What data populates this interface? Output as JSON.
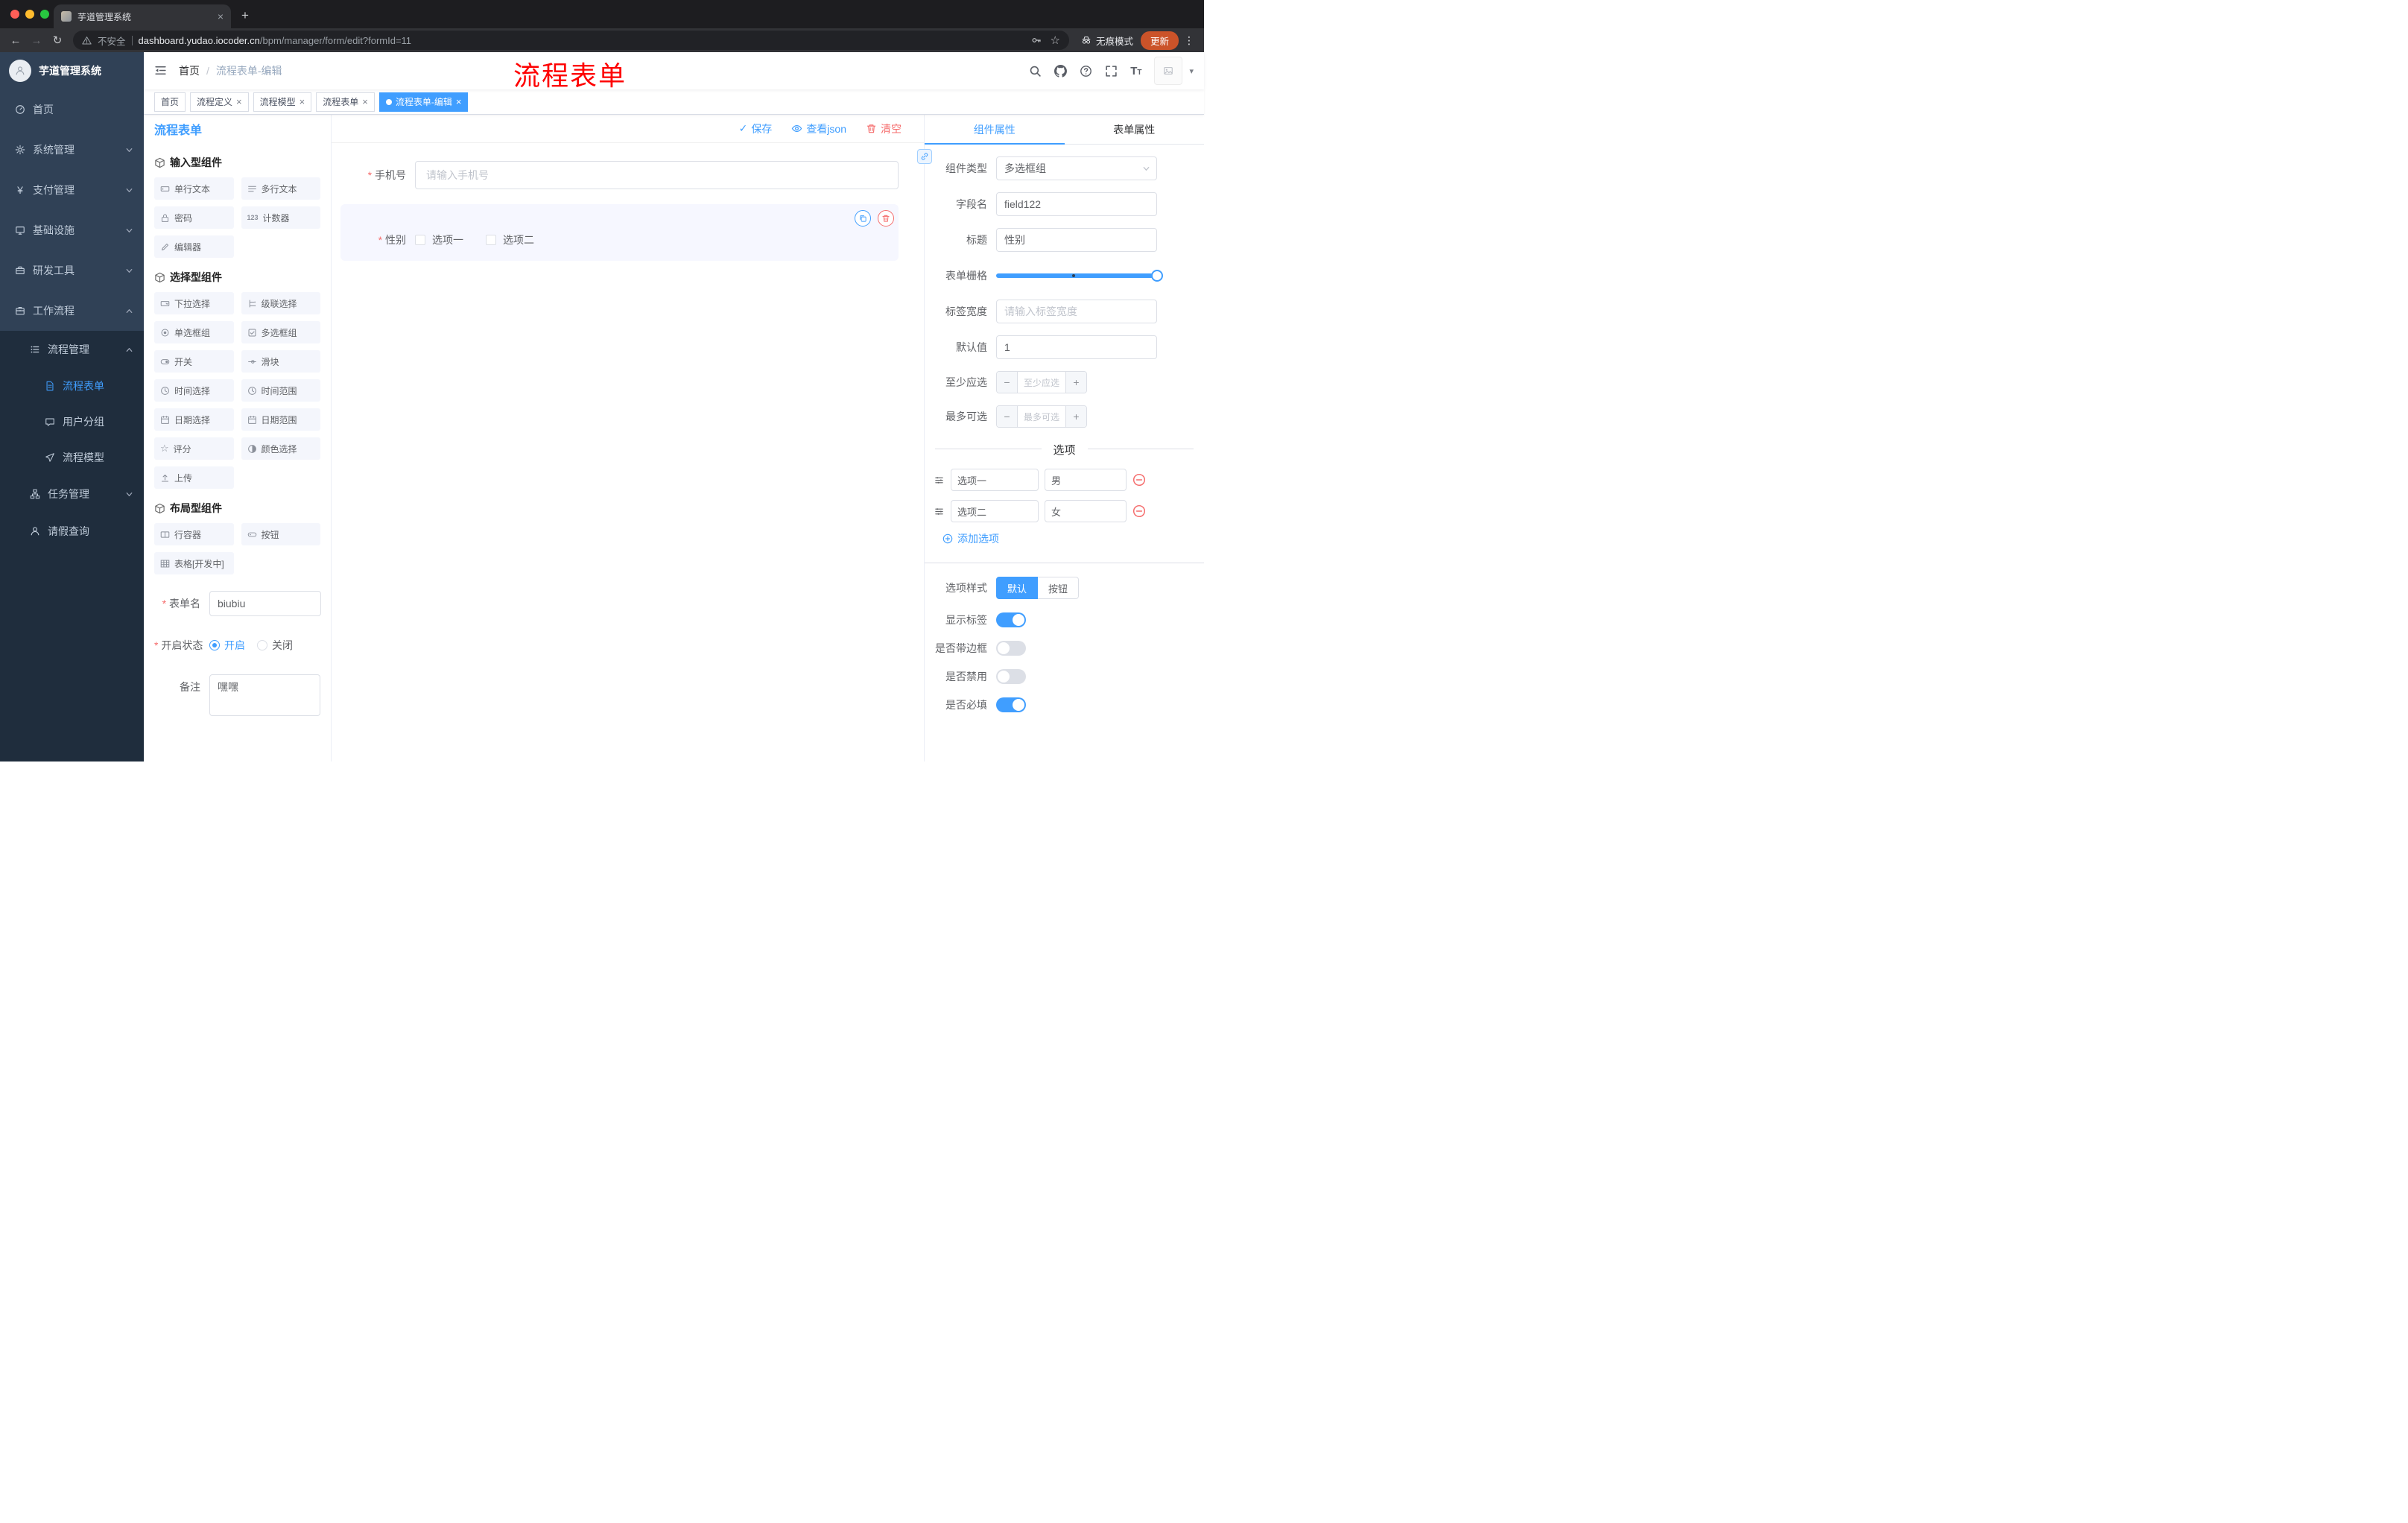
{
  "icons": {
    "close": "×",
    "check": "✓",
    "plus": "+",
    "minus": "−",
    "kebab": "⋮",
    "back": "←",
    "forward": "→",
    "reload": "↻",
    "star": "☆",
    "yen": "¥",
    "counter": "123",
    "font_size": "T",
    "slash": "/",
    "caret": "▾"
  },
  "browser": {
    "tab_title": "芋道管理系统",
    "security_label": "不安全",
    "url_host": "dashboard.yudao.iocoder.cn",
    "url_path": "/bpm/manager/form/edit?formId=11",
    "incognito_label": "无痕模式",
    "update_label": "更新"
  },
  "sidebar": {
    "logo_title": "芋道管理系统",
    "items": [
      {
        "label": "首页"
      },
      {
        "label": "系统管理"
      },
      {
        "label": "支付管理"
      },
      {
        "label": "基础设施"
      },
      {
        "label": "研发工具"
      },
      {
        "label": "工作流程"
      },
      {
        "label": "流程管理"
      },
      {
        "label": "流程表单"
      },
      {
        "label": "用户分组"
      },
      {
        "label": "流程模型"
      },
      {
        "label": "任务管理"
      },
      {
        "label": "请假查询"
      }
    ]
  },
  "header": {
    "breadcrumb": [
      "首页",
      "流程表单-编辑"
    ],
    "annotation": "流程表单"
  },
  "tags": [
    {
      "label": "首页"
    },
    {
      "label": "流程定义"
    },
    {
      "label": "流程模型"
    },
    {
      "label": "流程表单"
    },
    {
      "label": "流程表单-编辑"
    }
  ],
  "palette": {
    "title": "流程表单",
    "groups": [
      {
        "title": "输入型组件",
        "items": [
          "单行文本",
          "多行文本",
          "密码",
          "计数器",
          "编辑器"
        ]
      },
      {
        "title": "选择型组件",
        "items": [
          "下拉选择",
          "级联选择",
          "单选框组",
          "多选框组",
          "开关",
          "滑块",
          "时间选择",
          "时间范围",
          "日期选择",
          "日期范围",
          "评分",
          "颜色选择",
          "上传"
        ]
      },
      {
        "title": "布局型组件",
        "items": [
          "行容器",
          "按钮",
          "表格[开发中]"
        ]
      }
    ],
    "form": {
      "name_label": "表单名",
      "name_value": "biubiu",
      "status_label": "开启状态",
      "status_on": "开启",
      "status_off": "关闭",
      "remark_label": "备注",
      "remark_value": "嘿嘿"
    }
  },
  "canvas": {
    "save": "保存",
    "view_json": "查看json",
    "clear": "清空",
    "phone_label": "手机号",
    "phone_placeholder": "请输入手机号",
    "gender_label": "性别",
    "gender_options": [
      "选项一",
      "选项二"
    ]
  },
  "panel": {
    "tabs": [
      "组件属性",
      "表单属性"
    ],
    "component_type_label": "组件类型",
    "component_type_value": "多选框组",
    "field_label": "字段名",
    "field_value": "field122",
    "title_label": "标题",
    "title_value": "性别",
    "grid_label": "表单栅格",
    "label_width_label": "标签宽度",
    "label_width_placeholder": "请输入标签宽度",
    "default_label": "默认值",
    "default_value": "1",
    "min_label": "至少应选",
    "min_placeholder": "至少应选",
    "max_label": "最多可选",
    "max_placeholder": "最多可选",
    "options_title": "选项",
    "options": [
      {
        "name": "选项一",
        "value": "男"
      },
      {
        "name": "选项二",
        "value": "女"
      }
    ],
    "add_option": "添加选项",
    "style_label": "选项样式",
    "style_default": "默认",
    "style_button": "按钮",
    "show_label": "显示标签",
    "border_label": "是否带边框",
    "disabled_label": "是否禁用",
    "required_label": "是否必填"
  }
}
